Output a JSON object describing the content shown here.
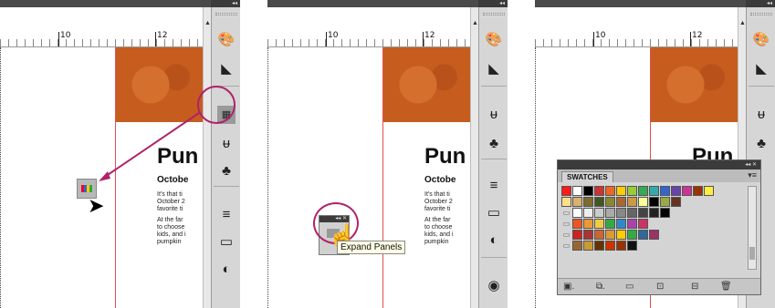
{
  "ruler": {
    "label_10": "10",
    "label_12": "12"
  },
  "dock": {
    "collapse": "◂◂"
  },
  "page": {
    "title": "Pun",
    "subtitle": "Octobe",
    "para1": "It's that ti\nOctober 2\nfavorite ti",
    "para2": "At the far\nto choose\nkids, and i\npumpkin"
  },
  "frame2": {
    "tooltip": "Expand Panels"
  },
  "swatches": {
    "tab": "SWATCHES",
    "collapse": "◂◂ ✕",
    "menu": "▾≡",
    "rows": [
      [
        "#ff1a1a",
        "#ffffff",
        "#000000",
        "#cc3333",
        "#ee6622",
        "#ffcc00",
        "#99cc33",
        "#33aa55",
        "#33aaaa",
        "#3366cc",
        "#6644aa",
        "#cc3399",
        "#993300",
        "#ffee44"
      ],
      [
        "#ffe08a",
        "#d9b26e",
        "#7f6b30",
        "#445522",
        "#888833",
        "#aa6633",
        "#cc9944",
        "#ffff99",
        "#000000",
        "#99aa44",
        "#663322"
      ],
      [
        "#ffffff",
        "#eeeeee",
        "#cccccc",
        "#aaaaaa",
        "#888888",
        "#666666",
        "#444444",
        "#222222",
        "#000000"
      ],
      [
        "#ee5522",
        "#ee9933",
        "#eecc44",
        "#33aa44",
        "#3388cc",
        "#aa44aa",
        "#cc3366"
      ],
      [
        "#cc2222",
        "#aa3333",
        "#cc6633",
        "#dd9933",
        "#ffcc00",
        "#33aa44",
        "#336699",
        "#993366"
      ],
      [
        "#996633",
        "#cc9933",
        "#663300",
        "#cc3300",
        "#993300",
        "#111111"
      ]
    ],
    "buttons": [
      "▣.",
      "⧉.",
      "▭",
      "⊡",
      "⊟",
      "🗑"
    ]
  }
}
